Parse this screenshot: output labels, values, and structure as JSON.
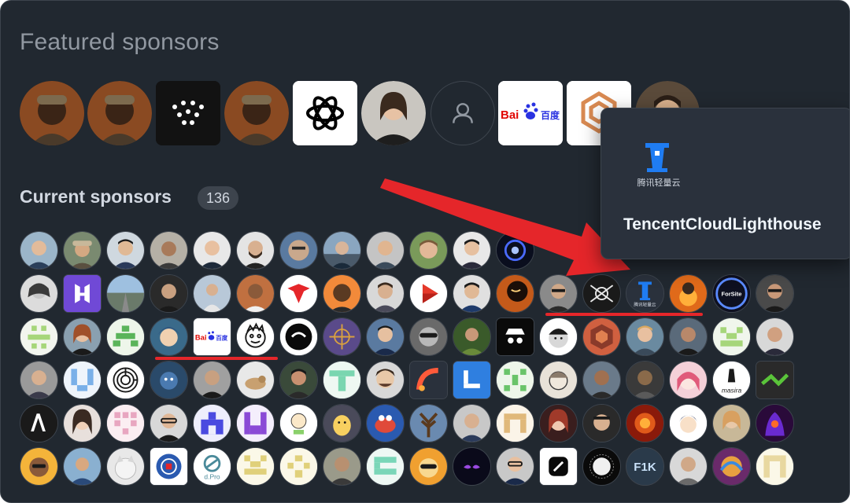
{
  "featured": {
    "title": "Featured sponsors",
    "sponsors": [
      {
        "kind": "portrait"
      },
      {
        "kind": "portrait"
      },
      {
        "kind": "dots-logo"
      },
      {
        "kind": "portrait"
      },
      {
        "kind": "openai-logo"
      },
      {
        "kind": "woman-portrait"
      },
      {
        "kind": "default-avatar-icon"
      },
      {
        "kind": "baidu-logo",
        "text": "Bai百度"
      },
      {
        "kind": "hexagon-logo"
      },
      {
        "kind": "portrait-partial"
      }
    ]
  },
  "current": {
    "title": "Current sponsors",
    "count": "136"
  },
  "tooltip": {
    "caption": "腾讯轻量云",
    "name": "TencentCloudLighthouse"
  },
  "colors": {
    "panel_bg": "#212830",
    "highlight_red": "#e5262a",
    "accent_blue": "#1f6feb"
  },
  "grid_small_labels": {
    "baidu": "Bai百度",
    "forsite": "ForSite",
    "dpro": "d.Pro",
    "fik": "F1K",
    "lighthouse": "腾讯轻量云",
    "masira": "masira"
  }
}
